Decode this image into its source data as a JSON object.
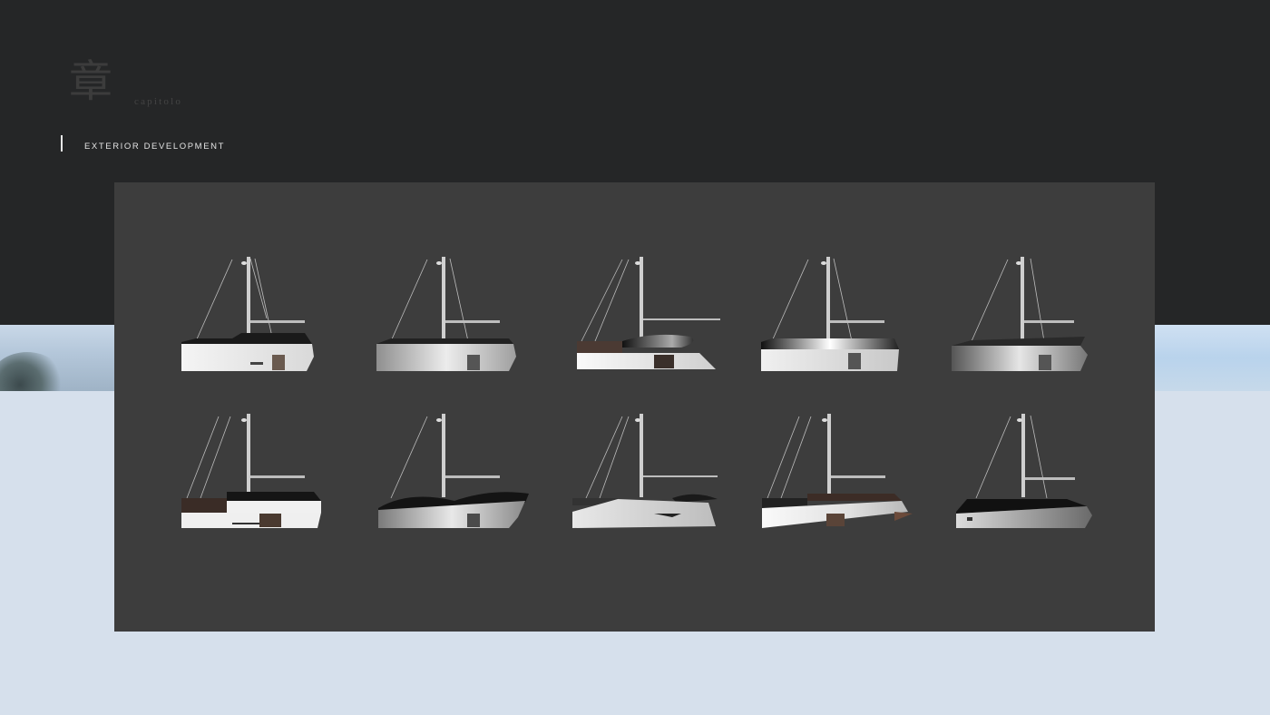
{
  "header": {
    "kanji": "章",
    "chapter_word": "capitolo",
    "section_title": "EXTERIOR DEVELOPMENT"
  },
  "colors": {
    "dark_band": "#252627",
    "panel": "#3d3d3d",
    "light_band": "#d6e0ec",
    "accent_text": "#e3e3e3"
  },
  "gallery": {
    "rows": 2,
    "columns": 5,
    "items": [
      {
        "variant": "white-hull-black-deck"
      },
      {
        "variant": "grey-gradient-hull"
      },
      {
        "variant": "wood-cabin-sculpted-roof"
      },
      {
        "variant": "black-deck-white-hull"
      },
      {
        "variant": "dark-gradient-hull"
      },
      {
        "variant": "wood-cabin-stepped"
      },
      {
        "variant": "black-swoop-roof"
      },
      {
        "variant": "silver-wedge-hull"
      },
      {
        "variant": "copper-bow-hull"
      },
      {
        "variant": "black-sleek-deck"
      }
    ]
  }
}
